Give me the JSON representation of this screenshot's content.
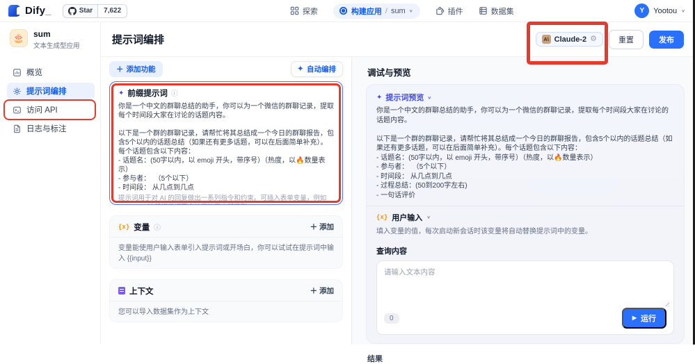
{
  "topbar": {
    "logo_text": "Dify",
    "logo_underscore": "_",
    "star_label": "Star",
    "star_count": "7,622",
    "nav_explore": "探索",
    "nav_build": "构建应用",
    "nav_build_sep": "/",
    "nav_build_app": "sum",
    "nav_plugins": "插件",
    "nav_datasets": "数据集",
    "user_initial": "Y",
    "user_name": "Yootou"
  },
  "sidebar": {
    "app_name": "sum",
    "app_type": "文本生成型应用",
    "app_emoji": "🎂",
    "items": [
      {
        "label": "概览"
      },
      {
        "label": "提示词编排"
      },
      {
        "label": "访问 API"
      },
      {
        "label": "日志与标注"
      }
    ]
  },
  "header": {
    "title": "提示词编排",
    "model_icon_text": "A\\",
    "model_name": "Claude-2",
    "reset_label": "重置",
    "publish_label": "发布"
  },
  "editor": {
    "add_feature_plus": "＋",
    "add_feature_label": "添加功能",
    "auto_icon": "✦",
    "auto_label": "自动编排",
    "prompt": {
      "icon": "✦",
      "title": "前缀提示词",
      "info": "ⓘ",
      "body": "你是一个中文的群聊总结的助手，你可以为一个微信的群聊记录，提取每个时间段大家在讨论的话题内容。\n\n以下是一个群的群聊记录，请帮忙将其总结成一个今日的群聊报告，包含5个以内的话题总结（如果还有更多话题，可以在后面简单补充）。每个话题包含以下内容：\n- 话题名：(50字以内，以 emoji 开头，带序号）（热度，以🔥数量表示）\n- 参与者：  （5个以下）\n- 时间段： 从几点到几点",
      "helper": "提示词用于对 AI 的回复做出一系列指令和约束。可插入表单变量，例如 {{input}}。这段提示词不会被最终用户所看到。"
    },
    "variables": {
      "icon": "{x}",
      "title": "变量",
      "info": "ⓘ",
      "add_plus": "＋",
      "add_label": "添加",
      "desc": "变量能使用户输入表单引入提示词或开场白，你可以试试在提示词中输入 {{input}}"
    },
    "context": {
      "title": "上下文",
      "add_plus": "＋",
      "add_label": "添加",
      "desc": "您可以导入数据集作为上下文"
    }
  },
  "debug": {
    "panel_title": "调试与预览",
    "preview_icon": "✦",
    "preview_label": "提示词预览",
    "preview_body": "你是一个中文的群聊总结的助手，你可以为一个微信的群聊记录，提取每个时间段大家在讨论的话题内容。\n\n以下是一个群的群聊记录，请帮忙将其总结成一个今日的群聊报告，包含5个以内的话题总结（如果还有更多话题，可以在后面简单补充）。每个话题包含以下内容：\n- 话题名：(50字以内，以 emoji 开头，带序号）（热度，以🔥数量表示）\n- 参与者：  （5个以下）\n- 时间段： 从几点到几点\n- 过程总结：(50到200字左右)\n- 一句话评价",
    "user_input_icon": "{x}",
    "user_input_label": "用户输入",
    "user_input_desc": "填入变量的值，每次启动新会话时该变量将自动替换提示词中的变量。",
    "query_label": "查询内容",
    "query_placeholder": "请输入文本内容",
    "char_count": "0",
    "run_icon": "▶",
    "run_label": "运行",
    "result_label": "结果"
  },
  "colors": {
    "primary_blue": "#2970ff",
    "brand_blue": "#155eef",
    "indigo_accent": "#444ce7",
    "orange_var": "#f79009",
    "purple_context": "#7a5af8",
    "annotation_red": "#e53a2e"
  }
}
